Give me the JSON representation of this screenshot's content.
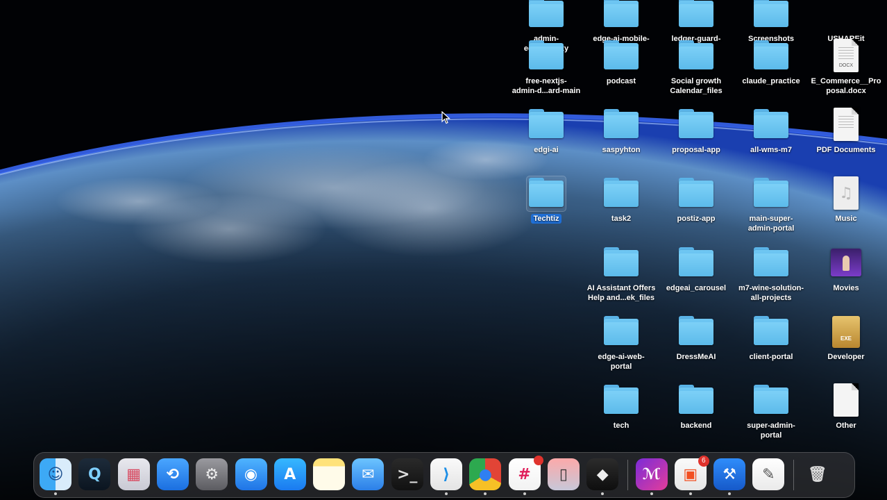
{
  "desktop": {
    "columns": [
      [
        {
          "label": "admin-\nedgeairealty",
          "kind": "folder",
          "partial": true
        },
        {
          "label": "free-nextjs-\nadmin-d...ard-main",
          "kind": "folder"
        },
        {
          "label": "edgi-ai",
          "kind": "folder"
        },
        {
          "label": "Techtiz",
          "kind": "folder",
          "selected": true
        }
      ],
      [
        {
          "label": "edge-ai-mobile-\napp",
          "kind": "folder",
          "partial": true
        },
        {
          "label": "podcast",
          "kind": "folder"
        },
        {
          "label": "saspyhton",
          "kind": "folder"
        },
        {
          "label": "task2",
          "kind": "folder"
        },
        {
          "label": "AI Assistant Offers\nHelp and...ek_files",
          "kind": "folder"
        },
        {
          "label": "edge-ai-web-\nportal",
          "kind": "folder"
        },
        {
          "label": "tech",
          "kind": "folder"
        }
      ],
      [
        {
          "label": "ledger-guard-\nproject",
          "kind": "folder",
          "partial": true
        },
        {
          "label": "Social growth\nCalendar_files",
          "kind": "folder"
        },
        {
          "label": "proposal-app",
          "kind": "folder"
        },
        {
          "label": "postiz-app",
          "kind": "folder"
        },
        {
          "label": "edgeai_carousel",
          "kind": "folder"
        },
        {
          "label": "DressMeAI",
          "kind": "folder"
        },
        {
          "label": "backend",
          "kind": "folder"
        }
      ],
      [
        {
          "label": "Screenshots",
          "kind": "folder",
          "partial": true
        },
        {
          "label": "claude_practice",
          "kind": "folder"
        },
        {
          "label": "all-wms-m7",
          "kind": "folder"
        },
        {
          "label": "main-super-\nadmin-portal",
          "kind": "folder"
        },
        {
          "label": "m7-wine-solution-\nall-projects",
          "kind": "folder"
        },
        {
          "label": "client-portal",
          "kind": "folder"
        },
        {
          "label": "super-admin-\nportal",
          "kind": "folder"
        }
      ],
      [
        {
          "label": "USHAREit",
          "kind": "app",
          "partial": true
        },
        {
          "label": "E_Commerce__Pro\nposal.docx",
          "kind": "docx",
          "tag": "DOCX"
        },
        {
          "label": "PDF Documents",
          "kind": "pdf-stack"
        },
        {
          "label": "Music",
          "kind": "music"
        },
        {
          "label": "Movies",
          "kind": "movies"
        },
        {
          "label": "Developer",
          "kind": "exe",
          "tag": "EXE"
        },
        {
          "label": "Other",
          "kind": "blank-doc"
        }
      ]
    ]
  },
  "dock": {
    "apps": [
      {
        "name": "Finder",
        "icon": "finder-icon",
        "running": true
      },
      {
        "name": "QuickTime",
        "icon": "quicktime-icon"
      },
      {
        "name": "Launchpad",
        "icon": "launchpad-icon"
      },
      {
        "name": "SHAREit",
        "icon": "shareit-icon"
      },
      {
        "name": "System Settings",
        "icon": "gear-icon"
      },
      {
        "name": "Safari",
        "icon": "compass-icon"
      },
      {
        "name": "App Store",
        "icon": "appstore-icon"
      },
      {
        "name": "Notes",
        "icon": "notes-icon"
      },
      {
        "name": "Mail",
        "icon": "mail-icon"
      },
      {
        "name": "Terminal",
        "icon": "terminal-icon"
      },
      {
        "name": "Visual Studio Code",
        "icon": "vscode-icon",
        "running": true
      },
      {
        "name": "Google Chrome",
        "icon": "chrome-icon",
        "running": true
      },
      {
        "name": "Slack",
        "icon": "slack-icon",
        "running": true,
        "badge_dot": true
      },
      {
        "name": "iPhone Mirroring",
        "icon": "phone-icon"
      },
      {
        "name": "Unity Hub",
        "icon": "cube-icon",
        "running": true
      }
    ],
    "recent": [
      {
        "name": "Microsoft Loop",
        "icon": "loop-icon",
        "running": true
      },
      {
        "name": "Microsoft Store",
        "icon": "store-icon",
        "running": true,
        "badge": "6"
      },
      {
        "name": "Xcode",
        "icon": "hammer-icon",
        "running": true
      },
      {
        "name": "TextEdit",
        "icon": "textedit-icon"
      }
    ],
    "trash": {
      "name": "Trash",
      "icon": "trash-icon"
    }
  }
}
